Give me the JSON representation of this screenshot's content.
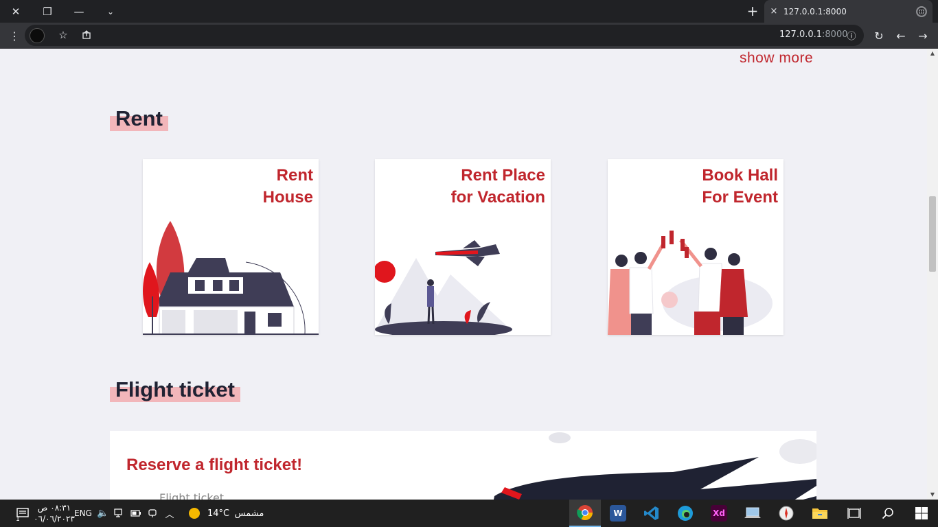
{
  "browser": {
    "tab_title": "127.0.0.1:8000",
    "url_host": "127.0.0.1",
    "url_port": ":8000",
    "new_tab": "+",
    "close_tab": "×"
  },
  "page": {
    "show_more": "show more",
    "rent_title": "Rent",
    "cards": [
      {
        "line1": "Rent",
        "line2": "House"
      },
      {
        "line1": "Rent Place",
        "line2": "for Vacation"
      },
      {
        "line1": "Book Hall",
        "line2": "For Event"
      }
    ],
    "flight_title": "Flight ticket",
    "flight_heading": "Reserve a flight ticket!",
    "flight_sub": "Flight ticket"
  },
  "taskbar": {
    "time": "٠٨:٣١ ص",
    "date": "٠٦/٠٦/٢٠٢٣",
    "language": "ENG",
    "temperature": "14°C",
    "weather": "مشمس",
    "notification_count": "1"
  },
  "colors": {
    "accent": "#c0262d",
    "title_highlight": "#f2b6ba",
    "heading": "#1f2233"
  }
}
